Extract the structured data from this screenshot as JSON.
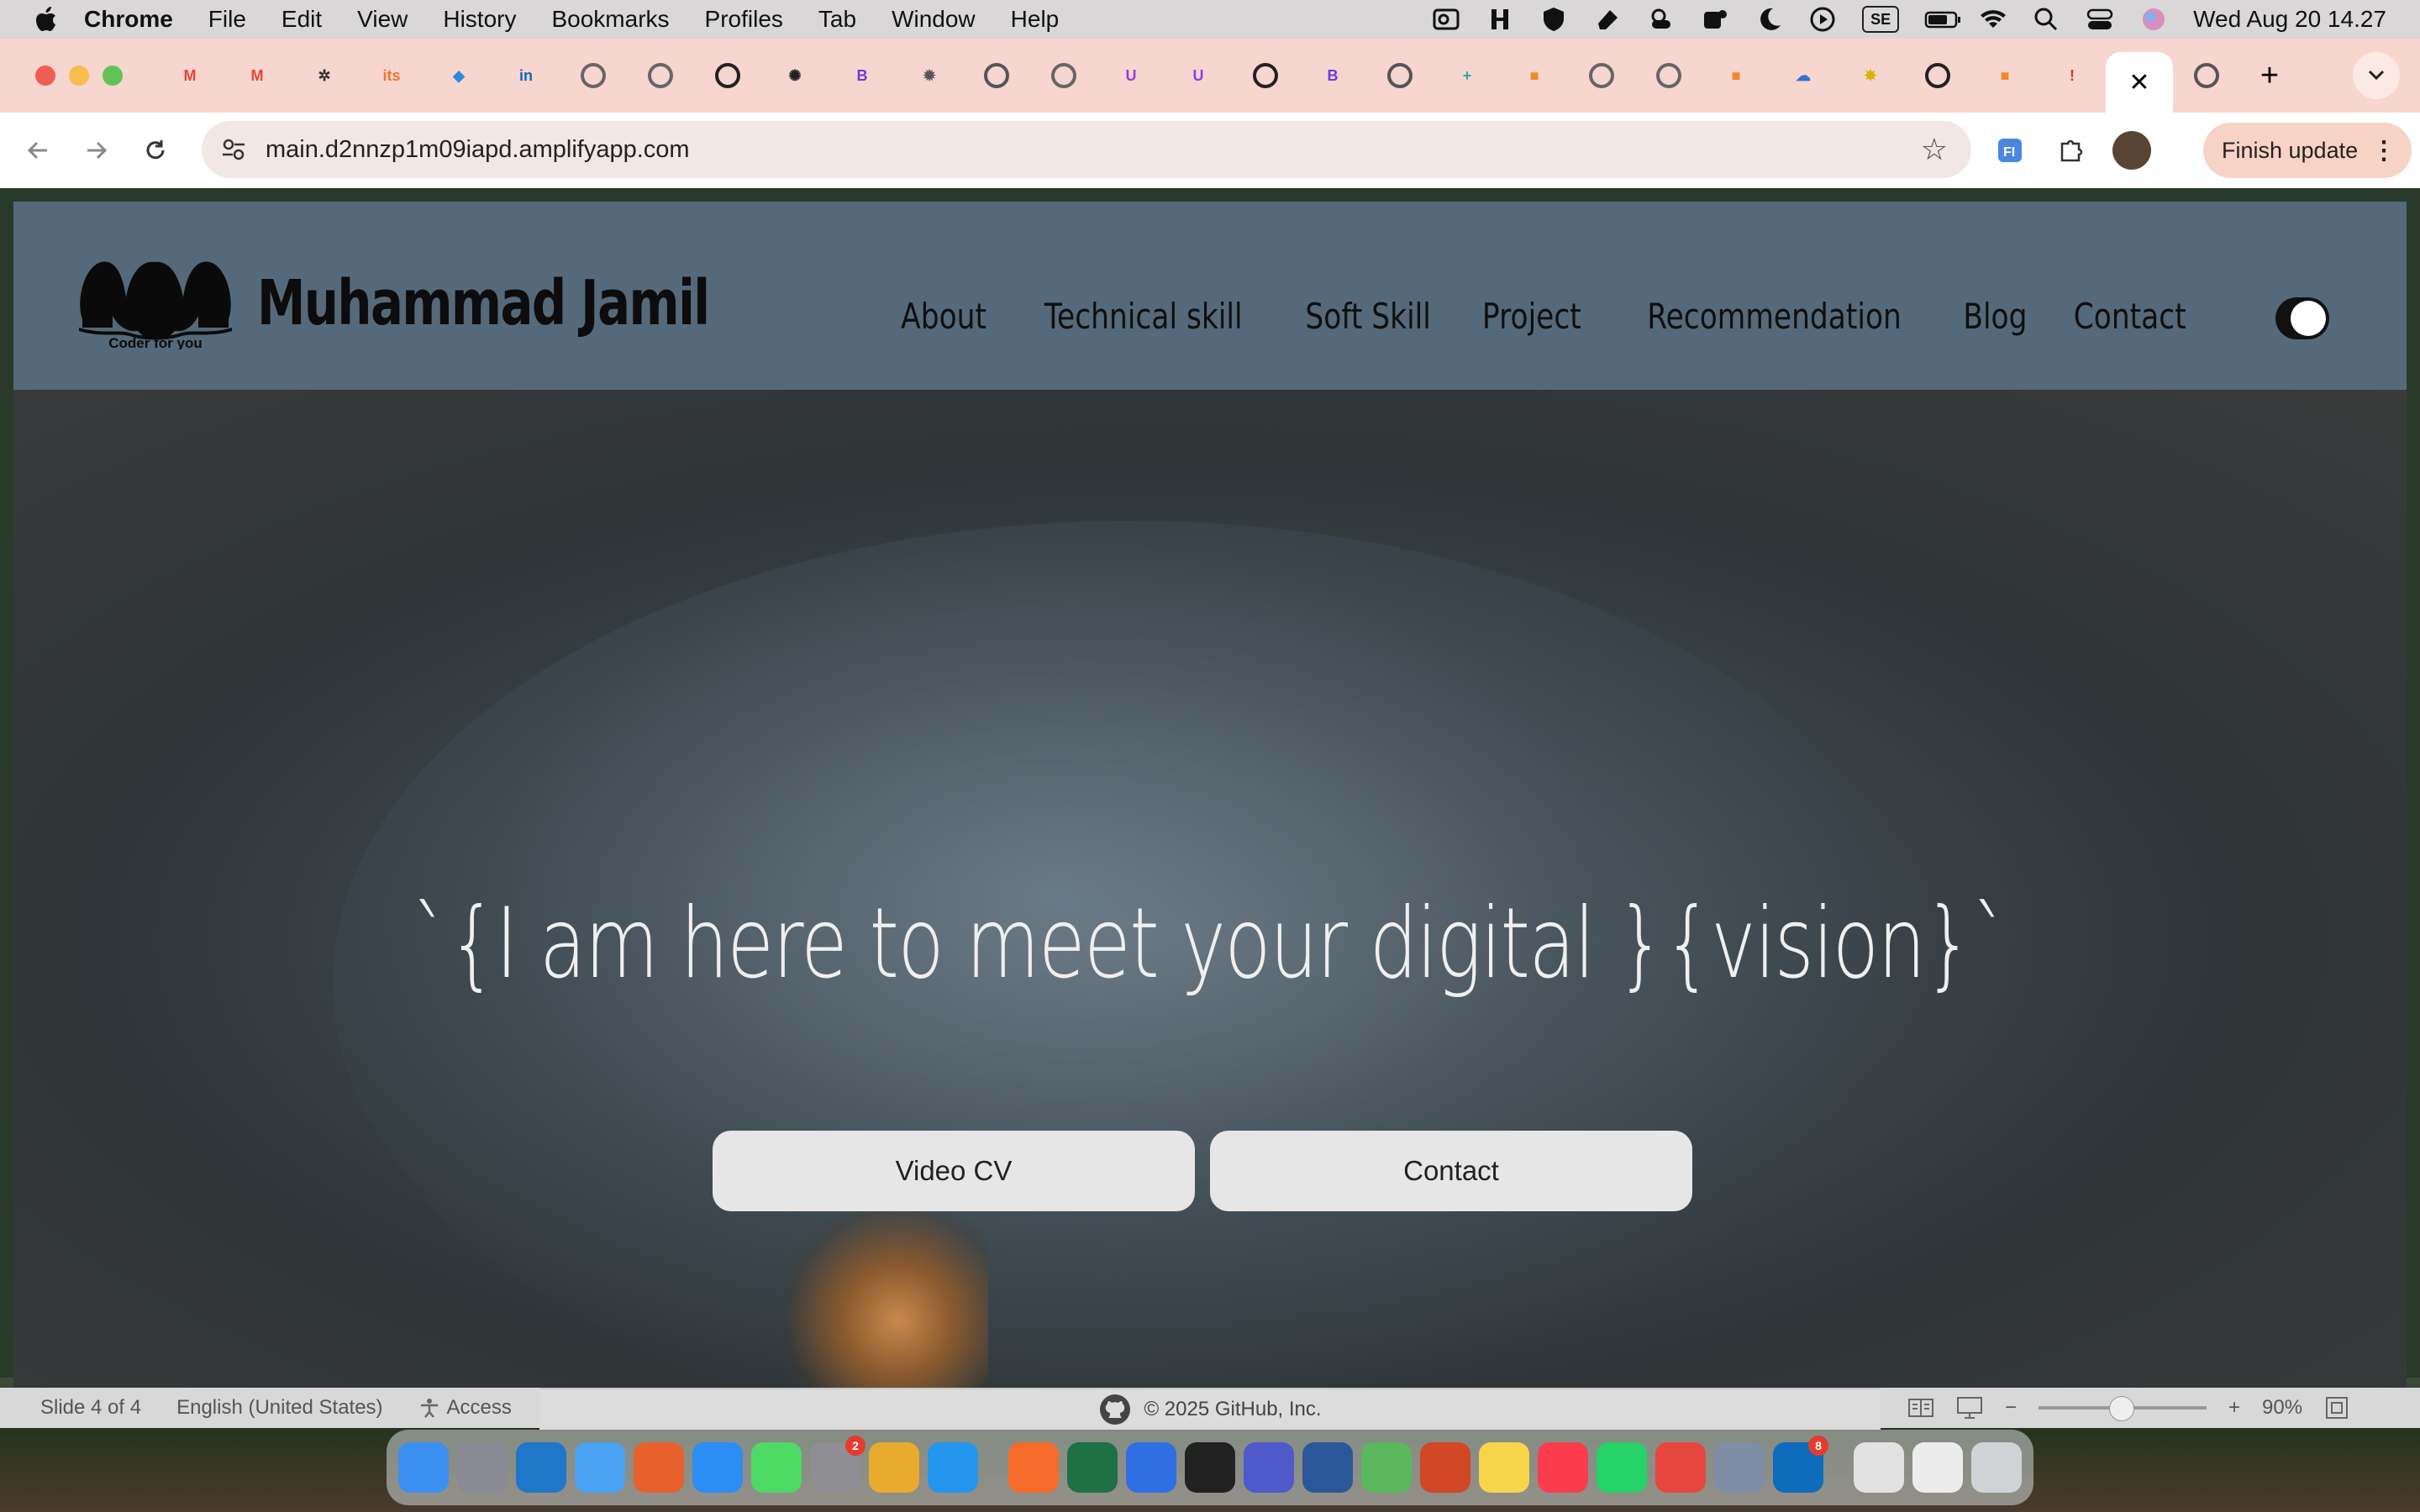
{
  "menubar": {
    "app_name": "Chrome",
    "items": [
      "File",
      "Edit",
      "View",
      "History",
      "Bookmarks",
      "Profiles",
      "Tab",
      "Window",
      "Help"
    ],
    "se_label": "SE",
    "datetime": "Wed Aug 20  14.27"
  },
  "tabs": {
    "favicons": [
      "gmail-icon",
      "gmail-icon",
      "gear-icon",
      "its-icon",
      "drupal-icon",
      "linkedin-icon",
      "globe-icon",
      "globe-icon",
      "github-icon",
      "openai-icon",
      "b-icon",
      "ai-icon",
      "chrome-icon",
      "globe-icon",
      "u-icon",
      "u-icon",
      "github-icon",
      "b-icon",
      "chrome-icon",
      "plus-icon",
      "box-icon",
      "globe-icon",
      "globe-icon",
      "box-icon",
      "cloud-icon",
      "bug-icon",
      "github-icon",
      "box-icon",
      "warning-icon"
    ],
    "active_close": "✕",
    "after_active": "chrome-icon",
    "new_tab": "+"
  },
  "toolbar": {
    "url": "main.d2nnzp1m09iapd.amplifyapp.com",
    "finish_update": "Finish update"
  },
  "site": {
    "logo_tagline": "Coder for you",
    "name": "Muhammad Jamil",
    "nav": [
      "About",
      "Technical skill",
      "Soft Skill",
      "Project",
      "Recommendation",
      "Blog",
      "Contact"
    ],
    "tagline": "`{I am here to meet your digital }{vision}`",
    "buttons": {
      "video_cv": "Video CV",
      "contact": "Contact"
    }
  },
  "statusbar": {
    "slide": "Slide 4 of 4",
    "language": "English (United States)",
    "accessibility": "Access",
    "github_copyright": "© 2025 GitHub, Inc.",
    "zoom": "90%"
  },
  "dock": {
    "apps": [
      {
        "name": "finder-icon",
        "color": "#3b8ff0"
      },
      {
        "name": "launchpad-icon",
        "color": "#8a8a95"
      },
      {
        "name": "vscode-icon",
        "color": "#1f77c9"
      },
      {
        "name": "mail-icon",
        "color": "#4aa3f4"
      },
      {
        "name": "firefox-icon",
        "color": "#e8612c"
      },
      {
        "name": "app-store-icon",
        "color": "#2b8df5"
      },
      {
        "name": "messages-icon",
        "color": "#4cd964"
      },
      {
        "name": "settings-icon",
        "color": "#8e8e93",
        "badge": "2"
      },
      {
        "name": "chrome-icon",
        "color": "#e9ab2e"
      },
      {
        "name": "docker-icon",
        "color": "#2496ed"
      },
      {
        "name": "pencil-icon",
        "color": "#f56b2a"
      },
      {
        "name": "excel-icon",
        "color": "#1e7145"
      },
      {
        "name": "bluetooth-icon",
        "color": "#2f6fe3"
      },
      {
        "name": "terminal-icon",
        "color": "#222222"
      },
      {
        "name": "teams-icon",
        "color": "#5059c9"
      },
      {
        "name": "word-icon",
        "color": "#2b579a"
      },
      {
        "name": "maps-icon",
        "color": "#5bb85c"
      },
      {
        "name": "powerpoint-icon",
        "color": "#d24726"
      },
      {
        "name": "notes-icon",
        "color": "#f7d54a"
      },
      {
        "name": "music-icon",
        "color": "#fa3c4c"
      },
      {
        "name": "whatsapp-icon",
        "color": "#25d366"
      },
      {
        "name": "h-app-icon",
        "color": "#e6463d"
      },
      {
        "name": "preview-icon",
        "color": "#7d8ea5"
      },
      {
        "name": "outlook-icon",
        "color": "#0f6cbd",
        "badge": "8"
      },
      {
        "name": "window-thumb-icon",
        "color": "#e2e2e2"
      },
      {
        "name": "window-thumb-2-icon",
        "color": "#ececec"
      },
      {
        "name": "trash-icon",
        "color": "#cfd3d6"
      }
    ]
  }
}
